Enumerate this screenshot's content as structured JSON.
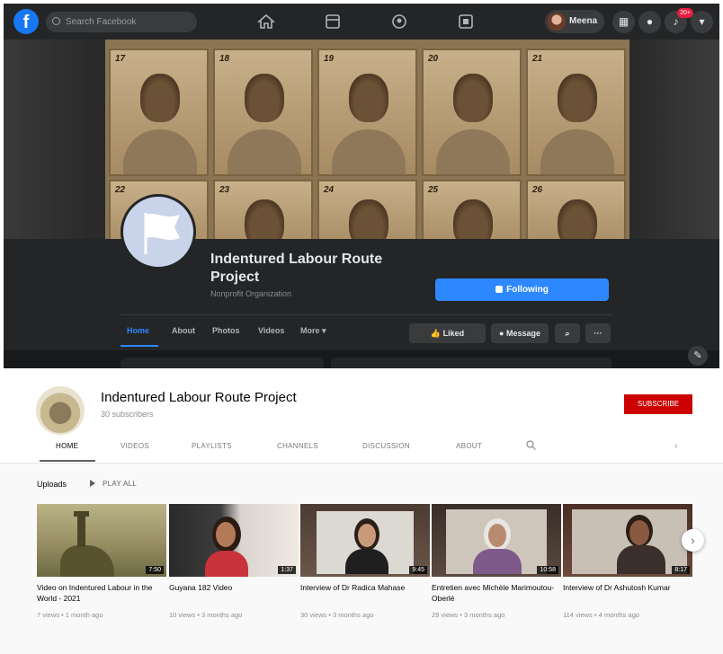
{
  "facebook": {
    "search_placeholder": "Search Facebook",
    "profile_name": "Meena",
    "notification_badge": "20+",
    "page_name": "Indentured Labour Route Project",
    "category": "Nonprofit Organization",
    "following_label": "Following",
    "tabs": [
      {
        "label": "Home",
        "active": true
      },
      {
        "label": "About"
      },
      {
        "label": "Photos"
      },
      {
        "label": "Videos"
      },
      {
        "label": "More ▾"
      }
    ],
    "actions": {
      "liked": "Liked",
      "message": "Message"
    },
    "cover_photo_numbers": [
      "17",
      "18",
      "19",
      "20",
      "21",
      "22",
      "23",
      "24",
      "25",
      "26"
    ],
    "colors": {
      "accent": "#2d88ff",
      "background": "#18191a",
      "surface": "#242526"
    }
  },
  "youtube": {
    "channel_name": "Indentured Labour Route Project",
    "subscribers": "30 subscribers",
    "subscribe_label": "SUBSCRIBE",
    "tabs": [
      {
        "label": "HOME",
        "active": true
      },
      {
        "label": "VIDEOS"
      },
      {
        "label": "PLAYLISTS"
      },
      {
        "label": "CHANNELS"
      },
      {
        "label": "DISCUSSION"
      },
      {
        "label": "ABOUT"
      }
    ],
    "section_title": "Uploads",
    "play_all": "PLAY ALL",
    "videos": [
      {
        "title": "Video on Indentured Labour in the World - 2021",
        "duration": "7:50",
        "meta": "7 views • 1 month ago"
      },
      {
        "title": "Guyana 182 Video",
        "duration": "1:37",
        "meta": "10 views • 3 months ago"
      },
      {
        "title": "Interview of Dr Radica Mahase",
        "duration": "9:45",
        "meta": "30 views • 3 months ago"
      },
      {
        "title": "Entretien avec Michèle Marimoutou-Oberlé",
        "duration": "10:58",
        "meta": "29 views • 3 months ago"
      },
      {
        "title": "Interview of Dr Ashutosh Kumar",
        "duration": "8:17",
        "meta": "114 views • 4 months ago"
      }
    ],
    "colors": {
      "subscribe": "#cc0000"
    }
  }
}
